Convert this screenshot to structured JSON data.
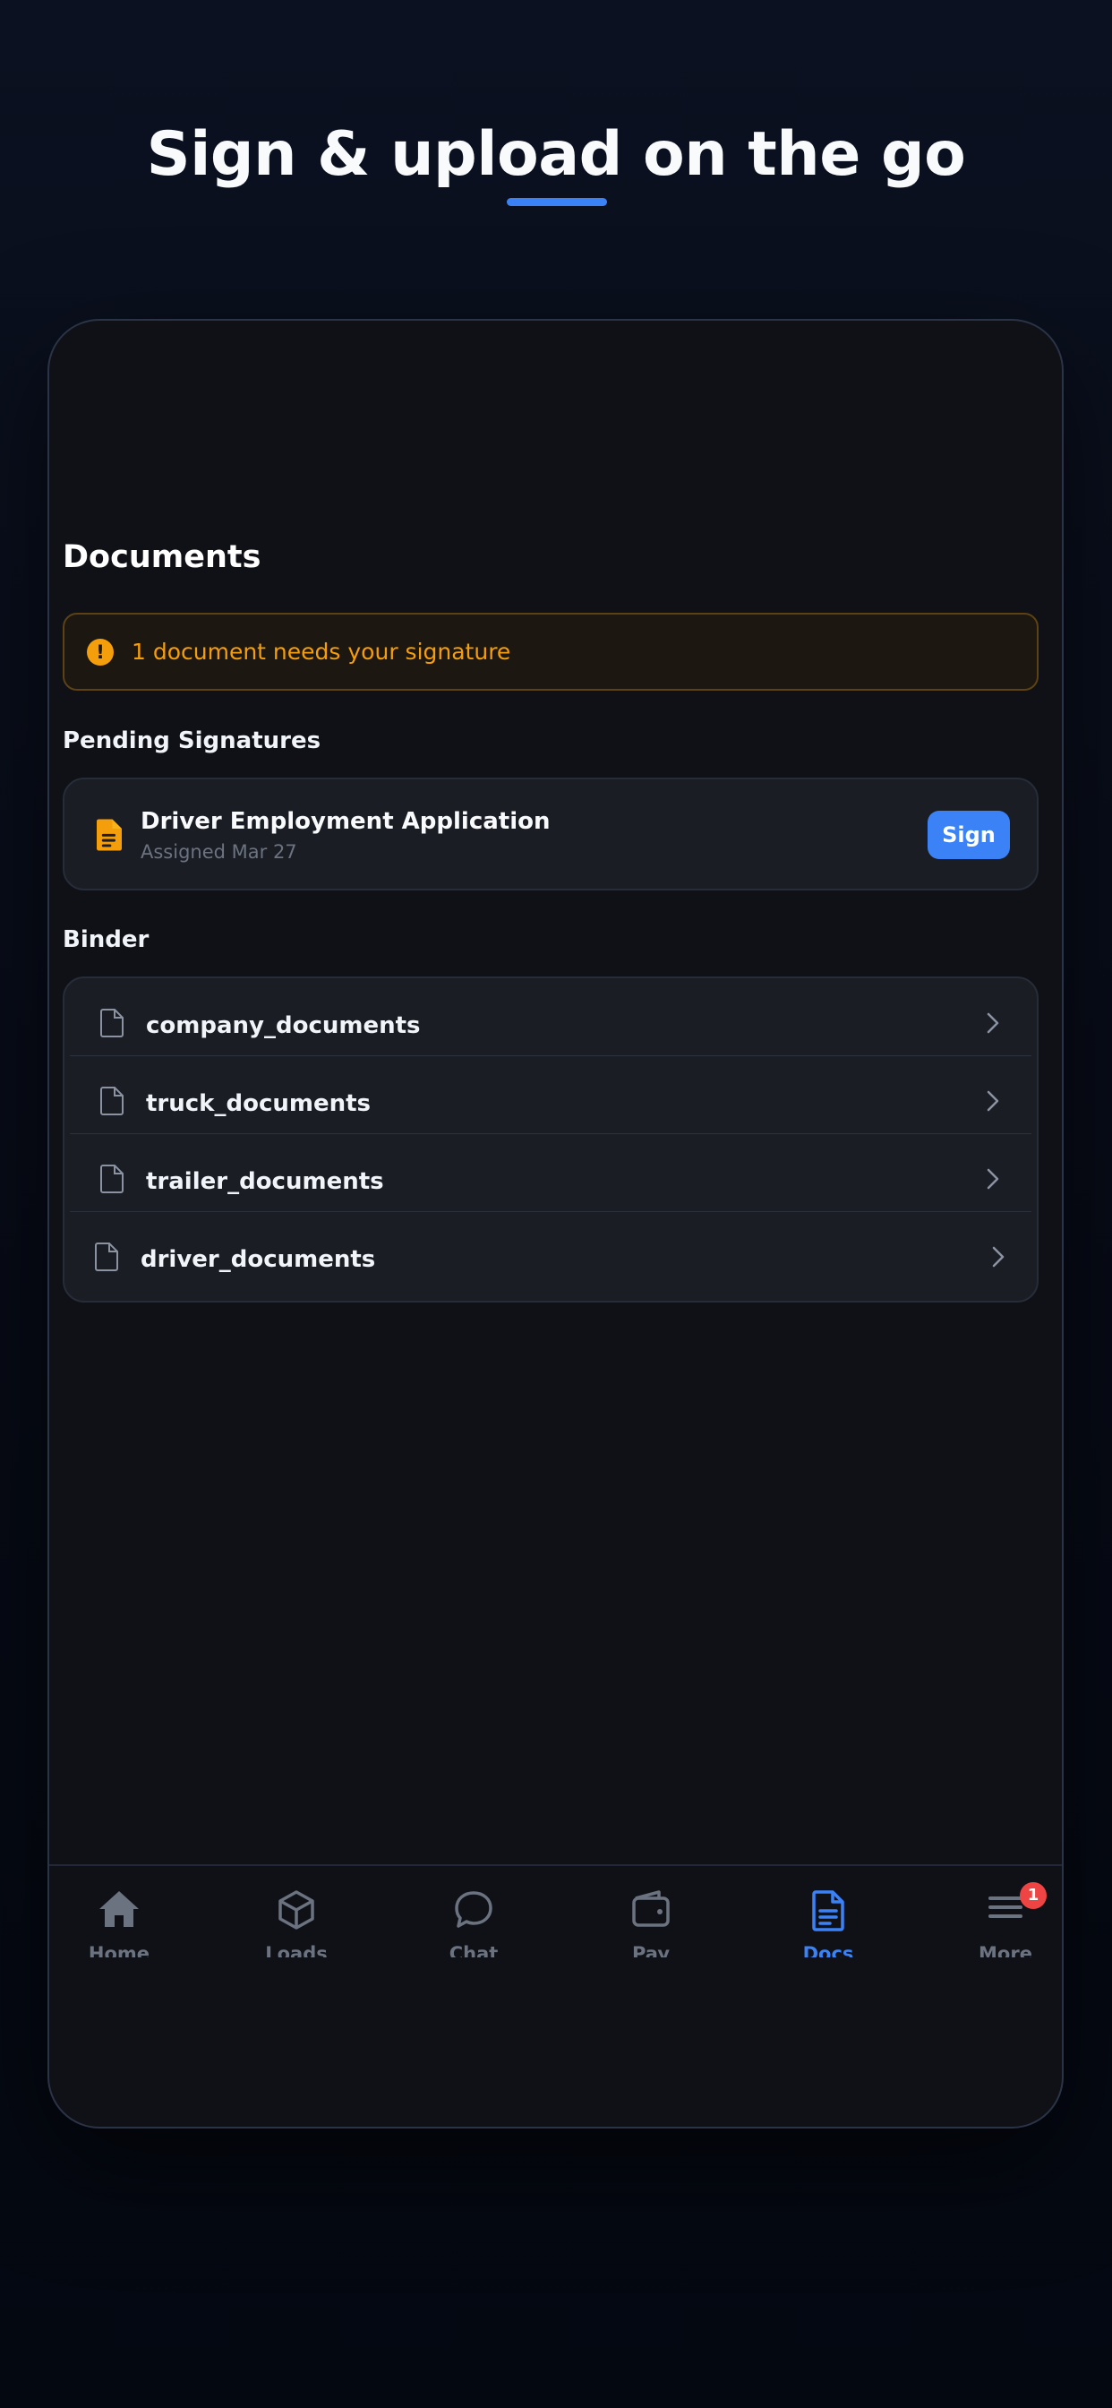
{
  "headline": "Sign & upload on the go",
  "colors": {
    "accent": "#3b82f6",
    "warning": "#f59e0b",
    "badge": "#ef4444",
    "screen_bg": "#101116",
    "card_bg": "#1a1d24"
  },
  "screen": {
    "title": "Documents",
    "alert": {
      "icon": "exclamation-circle-icon",
      "text": "1 document needs your signature"
    },
    "pending": {
      "section_title": "Pending Signatures",
      "items": [
        {
          "icon": "document-text-icon",
          "title": "Driver Employment Application",
          "subtitle": "Assigned Mar 27",
          "action_label": "Sign"
        }
      ]
    },
    "binder": {
      "section_title": "Binder",
      "items": [
        {
          "icon": "file-icon",
          "label": "company_documents"
        },
        {
          "icon": "file-icon",
          "label": "truck_documents"
        },
        {
          "icon": "file-icon",
          "label": "trailer_documents"
        },
        {
          "icon": "file-icon",
          "label": "driver_documents"
        }
      ]
    }
  },
  "tabbar": {
    "active": "Docs",
    "tabs": [
      {
        "label": "Home",
        "icon": "home-icon"
      },
      {
        "label": "Loads",
        "icon": "box-icon"
      },
      {
        "label": "Chat",
        "icon": "chat-bubble-icon"
      },
      {
        "label": "Pay",
        "icon": "wallet-icon"
      },
      {
        "label": "Docs",
        "icon": "document-icon"
      },
      {
        "label": "More",
        "icon": "menu-icon",
        "badge": "1"
      }
    ]
  }
}
